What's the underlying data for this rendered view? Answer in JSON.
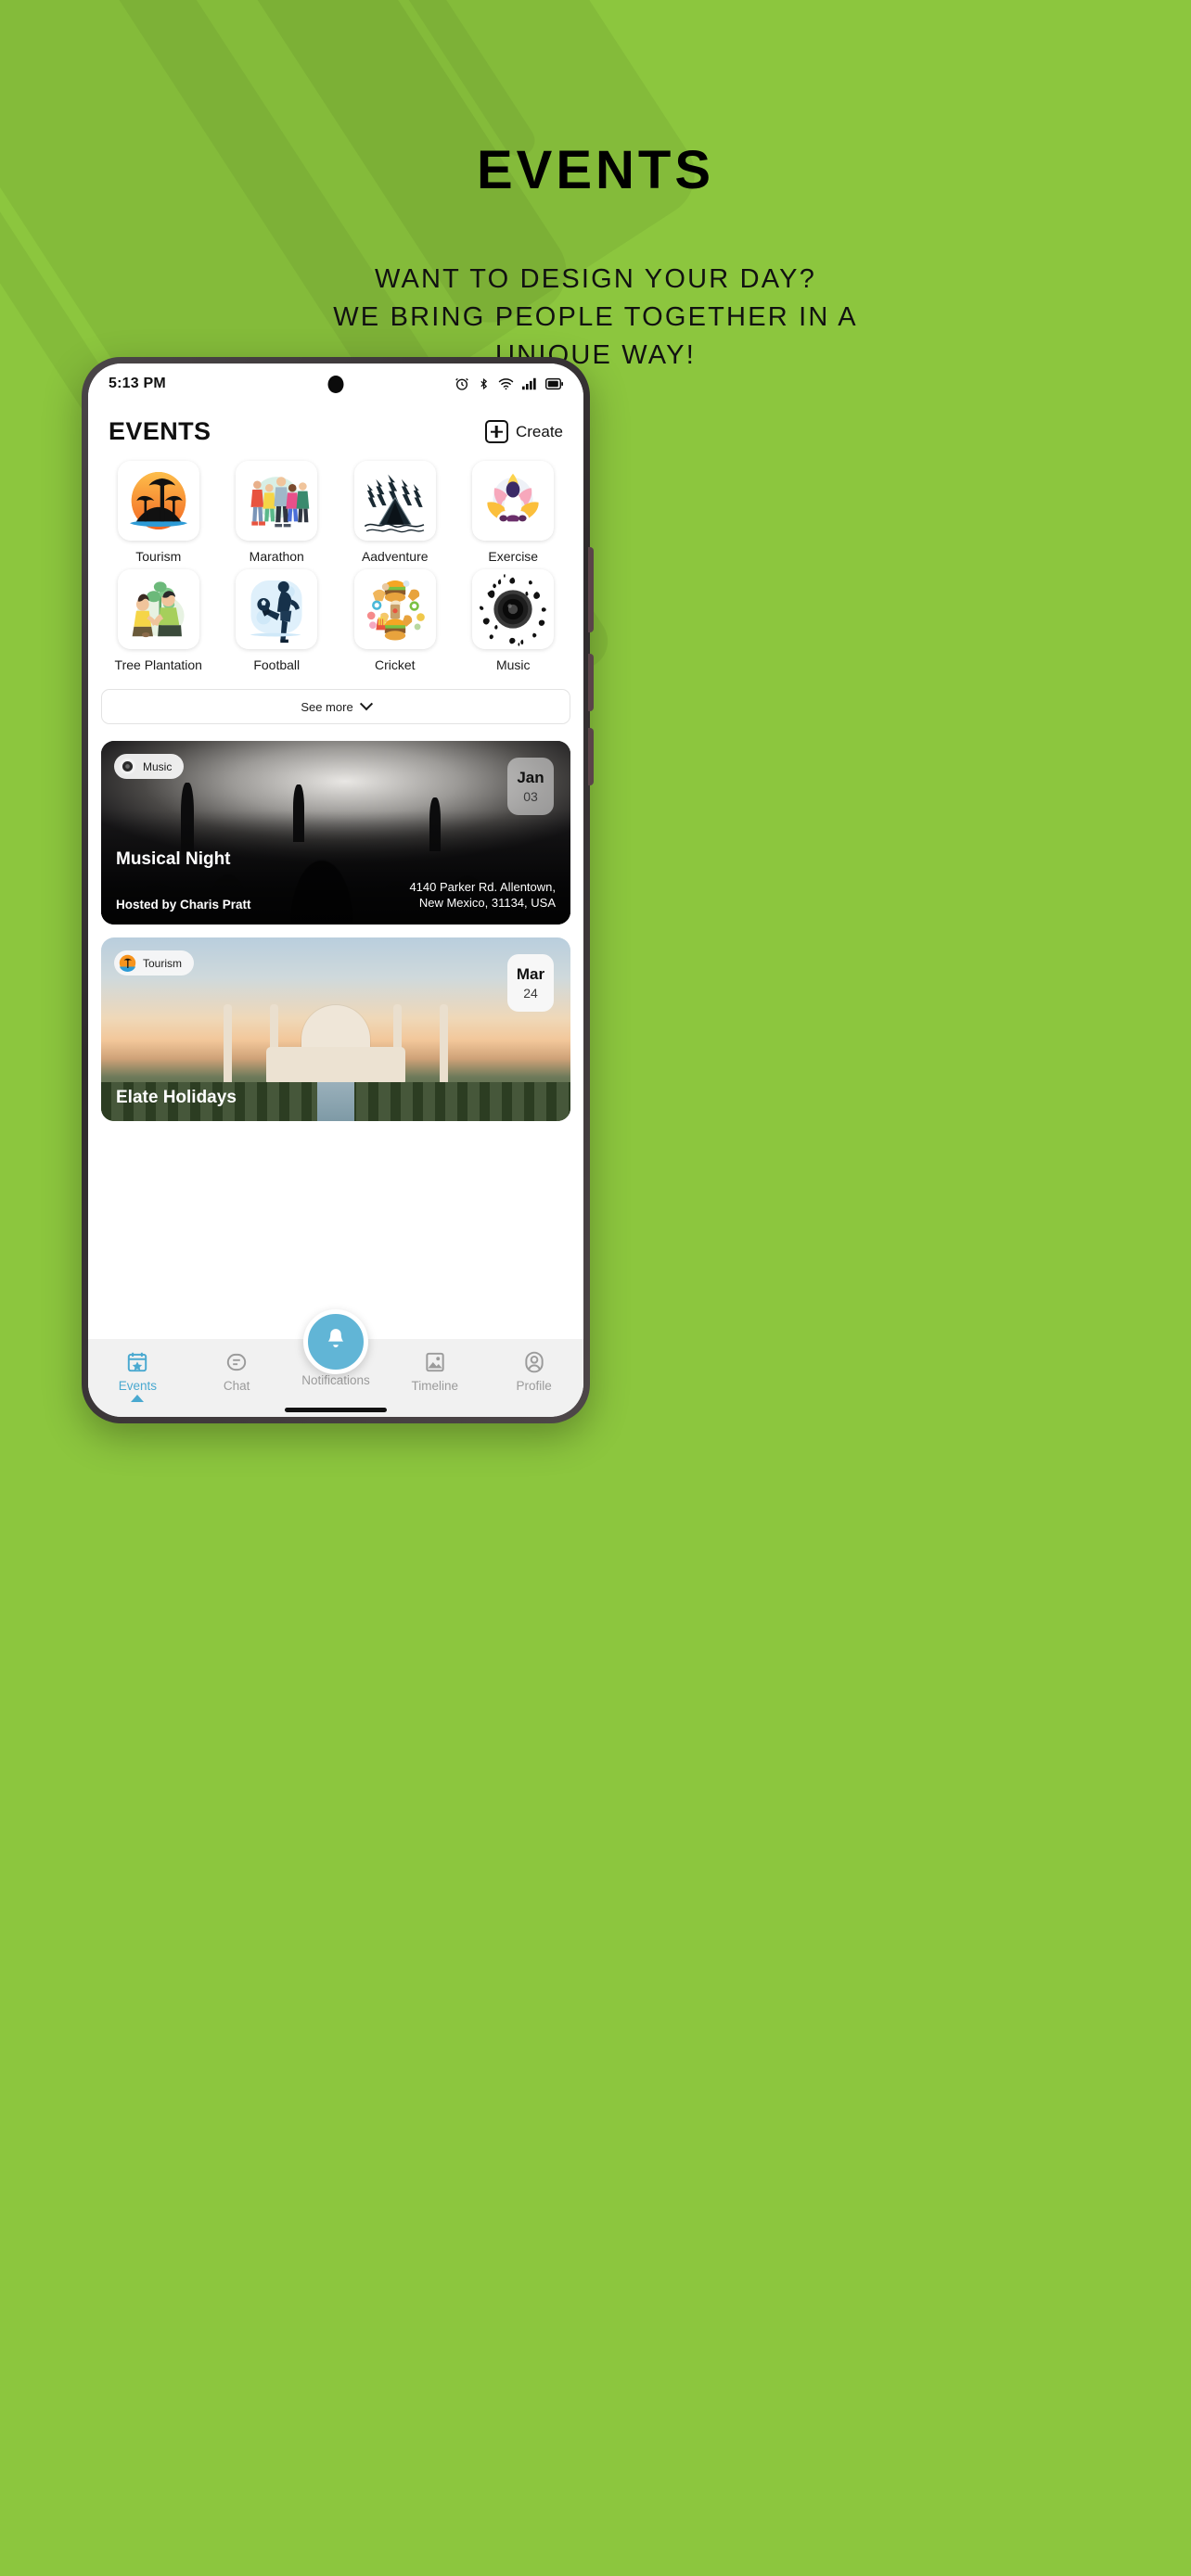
{
  "hero": {
    "title": "EVENTS",
    "subtitle": "WANT TO DESIGN YOUR DAY?\nWE BRING PEOPLE TOGETHER IN A\nUNIQUE WAY!"
  },
  "colors": {
    "background_green": "#8CC63E",
    "accent_blue": "#4AA9D0",
    "fab_blue": "#61B5D6",
    "nav_inactive": "#9B9B9B"
  },
  "statusbar": {
    "time": "5:13 PM",
    "icons": [
      "alarm-icon",
      "bluetooth-icon",
      "wifi-icon",
      "signal-icon",
      "battery-icon"
    ]
  },
  "app": {
    "title": "EVENTS",
    "create_label": "Create",
    "create_icon": "plus-square-icon"
  },
  "categories": [
    {
      "label": "Tourism",
      "icon": "palm-sunset-icon"
    },
    {
      "label": "Marathon",
      "icon": "runners-icon"
    },
    {
      "label": "Aadventure",
      "icon": "tent-forest-icon"
    },
    {
      "label": "Exercise",
      "icon": "yoga-lotus-icon"
    },
    {
      "label": "Tree Plantation",
      "icon": "planting-people-icon"
    },
    {
      "label": "Football",
      "icon": "footballer-icon"
    },
    {
      "label": "Cricket",
      "icon": "food-collage-icon"
    },
    {
      "label": "Music",
      "icon": "speaker-notes-icon"
    }
  ],
  "see_more": {
    "label": "See more",
    "icon": "chevron-down-icon"
  },
  "events": [
    {
      "category": "Music",
      "category_icon": "speaker-notes-icon",
      "month": "Jan",
      "day": "03",
      "title": "Musical Night",
      "host": "Hosted by Charis Pratt",
      "address": "4140 Parker Rd. Allentown,\nNew Mexico, 31134, USA"
    },
    {
      "category": "Tourism",
      "category_icon": "palm-sunset-icon",
      "month": "Mar",
      "day": "24",
      "title": "Elate Holidays",
      "host": "",
      "address": ""
    }
  ],
  "bottom_nav": {
    "fab_icon": "bell-icon",
    "items": [
      {
        "label": "Events",
        "icon": "calendar-star-icon",
        "active": true
      },
      {
        "label": "Chat",
        "icon": "chat-bubble-icon",
        "active": false
      },
      {
        "label": "Notifications",
        "icon": "bell-icon",
        "active": false
      },
      {
        "label": "Timeline",
        "icon": "image-icon",
        "active": false
      },
      {
        "label": "Profile",
        "icon": "person-circle-icon",
        "active": false
      }
    ]
  }
}
